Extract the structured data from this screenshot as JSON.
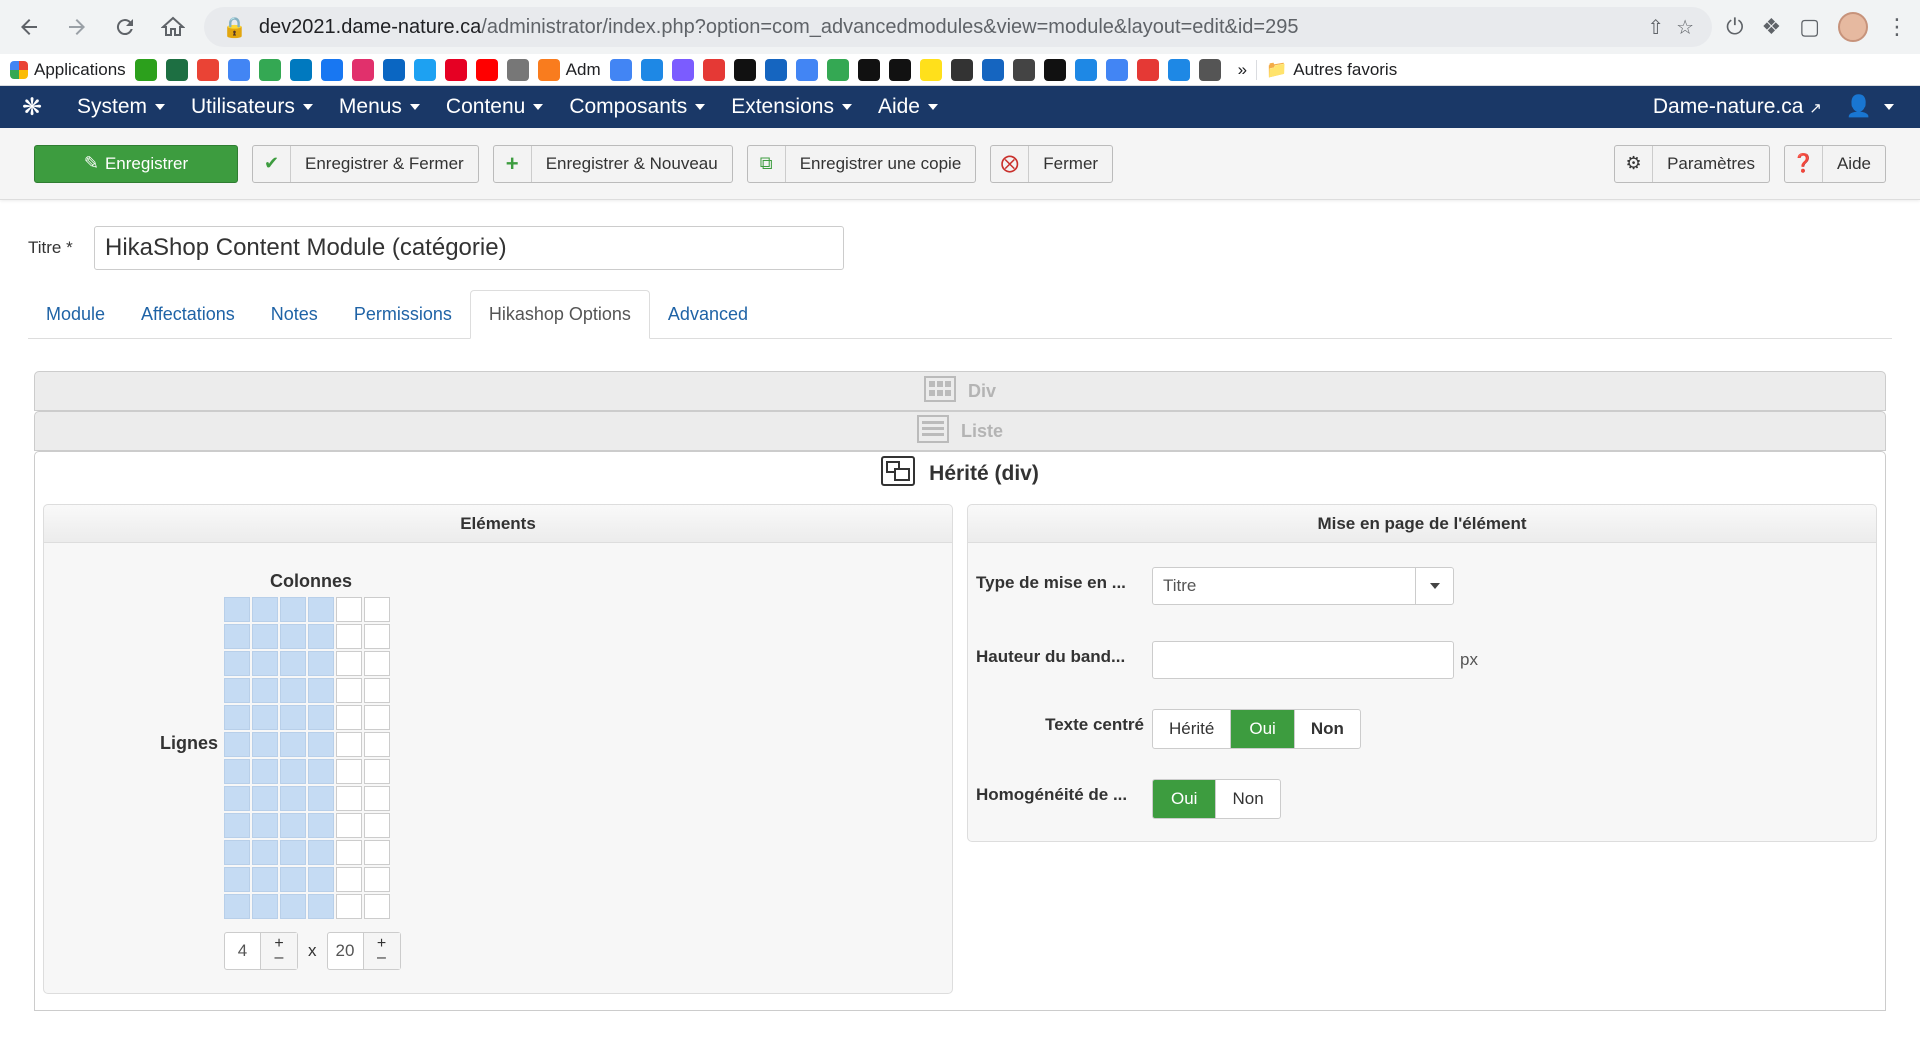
{
  "browser": {
    "url_host": "dev2021.dame-nature.ca",
    "url_path": "/administrator/index.php?option=com_advancedmodules&view=module&layout=edit&id=295",
    "bookmarks": [
      {
        "icon": "apps-grid-icon",
        "label": "Applications"
      },
      {
        "icon": "qb-icon",
        "label": ""
      },
      {
        "icon": "hexagon-icon",
        "label": ""
      },
      {
        "icon": "gmail-icon",
        "label": ""
      },
      {
        "icon": "calendar-icon",
        "label": ""
      },
      {
        "icon": "drive-icon",
        "label": ""
      },
      {
        "icon": "trello-icon",
        "label": ""
      },
      {
        "icon": "facebook-icon",
        "label": ""
      },
      {
        "icon": "instagram-icon",
        "label": ""
      },
      {
        "icon": "linkedin-icon",
        "label": ""
      },
      {
        "icon": "twitter-icon",
        "label": ""
      },
      {
        "icon": "pinterest-icon",
        "label": ""
      },
      {
        "icon": "youtube-icon",
        "label": ""
      },
      {
        "icon": "c-icon",
        "label": ""
      },
      {
        "icon": "joomla-icon",
        "label": "Adm"
      },
      {
        "icon": "google-icon",
        "label": ""
      },
      {
        "icon": "blocks-icon",
        "label": ""
      },
      {
        "icon": "circle-icon",
        "label": ""
      },
      {
        "icon": "stripes-icon",
        "label": ""
      },
      {
        "icon": "qr-icon",
        "label": ""
      },
      {
        "icon": "bot-icon",
        "label": ""
      },
      {
        "icon": "google-icon",
        "label": ""
      },
      {
        "icon": "diamond-icon",
        "label": ""
      },
      {
        "icon": "we-icon",
        "label": ""
      },
      {
        "icon": "z-icon",
        "label": ""
      },
      {
        "icon": "mailchimp-icon",
        "label": ""
      },
      {
        "icon": "qr-icon",
        "label": ""
      },
      {
        "icon": "flag-icon",
        "label": ""
      },
      {
        "icon": "dark-circle-icon",
        "label": ""
      },
      {
        "icon": "x-icon",
        "label": ""
      },
      {
        "icon": "image-icon",
        "label": ""
      },
      {
        "icon": "google-icon",
        "label": ""
      },
      {
        "icon": "chrome-icon",
        "label": ""
      },
      {
        "icon": "cloud-icon",
        "label": ""
      },
      {
        "icon": "doc-icon",
        "label": ""
      }
    ],
    "more": "»",
    "other_bookmarks": "Autres favoris"
  },
  "navbar": {
    "menu": [
      "System",
      "Utilisateurs",
      "Menus",
      "Contenu",
      "Composants",
      "Extensions",
      "Aide"
    ],
    "site_link": "Dame-nature.ca"
  },
  "toolbar": {
    "save": "Enregistrer",
    "save_close": "Enregistrer & Fermer",
    "save_new": "Enregistrer & Nouveau",
    "save_copy": "Enregistrer une copie",
    "close": "Fermer",
    "options": "Paramètres",
    "help": "Aide"
  },
  "form": {
    "title_label": "Titre *",
    "title_value": "HikaShop Content Module (catégorie)"
  },
  "tabs": [
    "Module",
    "Affectations",
    "Notes",
    "Permissions",
    "Hikashop Options",
    "Advanced"
  ],
  "active_tab": "Hikashop Options",
  "layout_types": {
    "div": "Div",
    "list": "Liste",
    "inherited": "Hérité (div)"
  },
  "elements_panel": {
    "title": "Eléments",
    "columns_label": "Colonnes",
    "rows_label": "Lignes",
    "columns_value": "4",
    "rows_value": "20",
    "separator": "x",
    "grid_selected_columns": 4,
    "grid_total_columns": 6,
    "grid_visible_rows": 12
  },
  "layout_panel": {
    "title": "Mise en page de l'élément",
    "type_label": "Type de mise en ...",
    "type_value": "Titre",
    "height_label": "Hauteur du band...",
    "height_value": "",
    "height_unit": "px",
    "center_label": "Texte centré",
    "center_options": [
      "Hérité",
      "Oui",
      "Non"
    ],
    "center_selected": "Oui",
    "homog_label": "Homogénéité de ...",
    "homog_options": [
      "Oui",
      "Non"
    ],
    "homog_selected": "Oui"
  },
  "colors": {
    "navbar": "#1a3867",
    "green": "#3d9c3f",
    "link": "#1f63a6",
    "grid_on": "#c5dbf3"
  }
}
